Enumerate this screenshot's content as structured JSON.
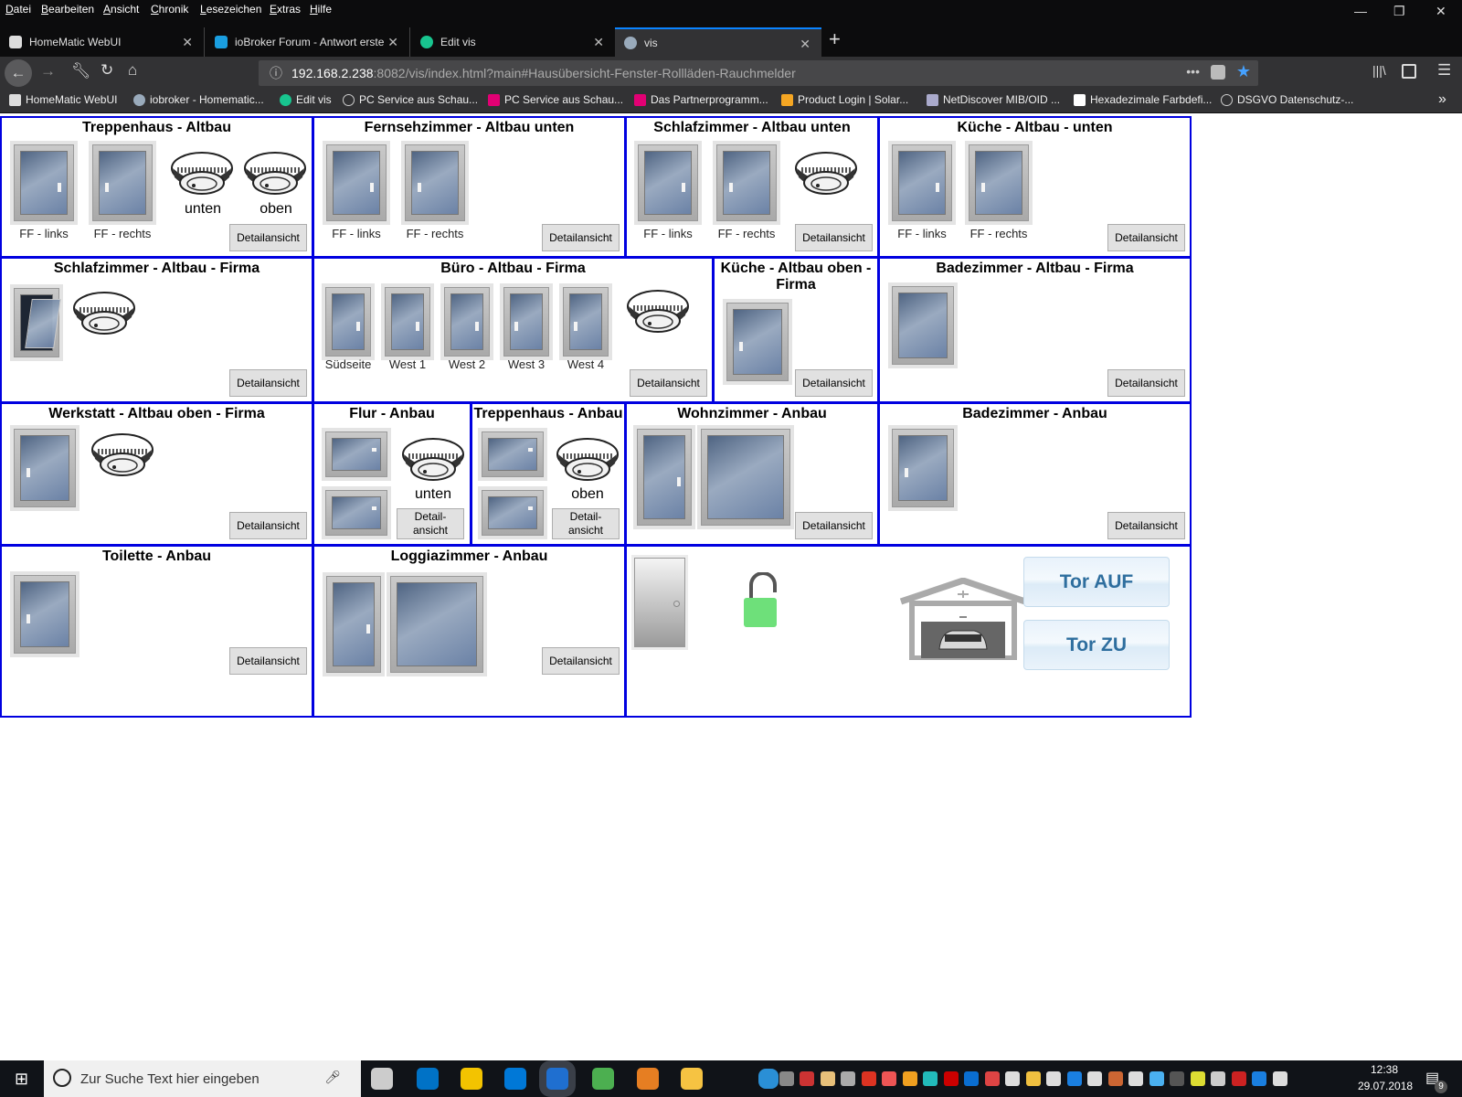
{
  "menu": [
    "Datei",
    "Bearbeiten",
    "Ansicht",
    "Chronik",
    "Lesezeichen",
    "Extras",
    "Hilfe"
  ],
  "tabs": [
    {
      "label": "HomeMatic WebUI",
      "icon": "homematic-icon"
    },
    {
      "label": "ioBroker Forum - Antwort erste",
      "icon": "iobroker-icon"
    },
    {
      "label": "Edit vis",
      "icon": "vis-edit-icon"
    },
    {
      "label": "vis",
      "icon": "vis-icon",
      "active": true
    }
  ],
  "url": {
    "host": "192.168.2.238",
    "rest": ":8082/vis/index.html?main#Hausübersicht-Fenster-Rollläden-Rauchmelder"
  },
  "bookmarks": [
    "HomeMatic WebUI",
    "iobroker - Homematic...",
    "Edit vis",
    "PC Service aus Schau...",
    "PC Service aus Schau...",
    "Das Partnerprogramm...",
    "Product Login | Solar...",
    "NetDiscover MIB/OID ...",
    "Hexadezimale Farbdefi...",
    "DSGVO Datenschutz-..."
  ],
  "detail_label": "Detailansicht",
  "detail_label_short": "Detail-ansicht",
  "panels": {
    "p1": {
      "title": "Treppenhaus - Altbau",
      "w": [
        "FF - links",
        "FF - rechts"
      ],
      "s": [
        "unten",
        "oben"
      ]
    },
    "p2": {
      "title": "Fernsehzimmer - Altbau unten",
      "w": [
        "FF - links",
        "FF - rechts"
      ]
    },
    "p3": {
      "title": "Schlafzimmer - Altbau unten",
      "w": [
        "FF - links",
        "FF - rechts"
      ]
    },
    "p4": {
      "title": "Küche - Altbau - unten",
      "w": [
        "FF - links",
        "FF - rechts"
      ]
    },
    "p5": {
      "title": "Schlafzimmer - Altbau - Firma",
      "window_state": "tilted"
    },
    "p6": {
      "title": "Büro - Altbau - Firma",
      "w": [
        "Südseite",
        "West 1",
        "West 2",
        "West 3",
        "West 4"
      ]
    },
    "p7": {
      "title": "Küche - Altbau oben - Firma"
    },
    "p8": {
      "title": "Badezimmer - Altbau - Firma"
    },
    "p9": {
      "title": "Werkstatt - Altbau oben - Firma"
    },
    "p10": {
      "title": "Flur - Anbau",
      "s": "unten"
    },
    "p11": {
      "title": "Treppenhaus - Anbau",
      "s": "oben"
    },
    "p12": {
      "title": "Wohnzimmer - Anbau"
    },
    "p13": {
      "title": "Badezimmer - Anbau"
    },
    "p14": {
      "title": "Toilette - Anbau"
    },
    "p15": {
      "title": "Loggiazimmer - Anbau"
    },
    "garage": {
      "door_state": "closed",
      "lock_state": "unlocked",
      "tor_auf": "Tor AUF",
      "tor_zu": "Tor ZU"
    }
  },
  "colors": {
    "panel_border": "#0000e0",
    "lock": "#6ee07a",
    "tor_text": "#2e6e9e"
  },
  "taskbar": {
    "search_placeholder": "Zur Suche Text hier eingeben",
    "time": "12:38",
    "date": "29.07.2018",
    "notifications": "9",
    "apps": [
      "task-view-icon",
      "outlook-icon",
      "internet-explorer-icon",
      "edge-icon",
      "firefox-icon",
      "chrome-icon",
      "media-player-icon",
      "file-explorer-icon"
    ],
    "tray": [
      "help-icon",
      "people-icon",
      "network-icon",
      "mail-icon",
      "device-icon",
      "camera-icon",
      "fox-icon",
      "norton-icon",
      "q-icon",
      "acrobat-icon",
      "outlook-tray-icon",
      "volume-app-icon",
      "usb-app-icon",
      "n-icon",
      "usb-icon",
      "teamviewer-icon",
      "network-drive-icon",
      "ccleaner-icon",
      "dropbox-icon",
      "icloud-icon",
      "audio-icon",
      "yellow-app-icon",
      "box-icon",
      "battery-icon",
      "bluetooth-icon",
      "speaker-icon"
    ]
  }
}
